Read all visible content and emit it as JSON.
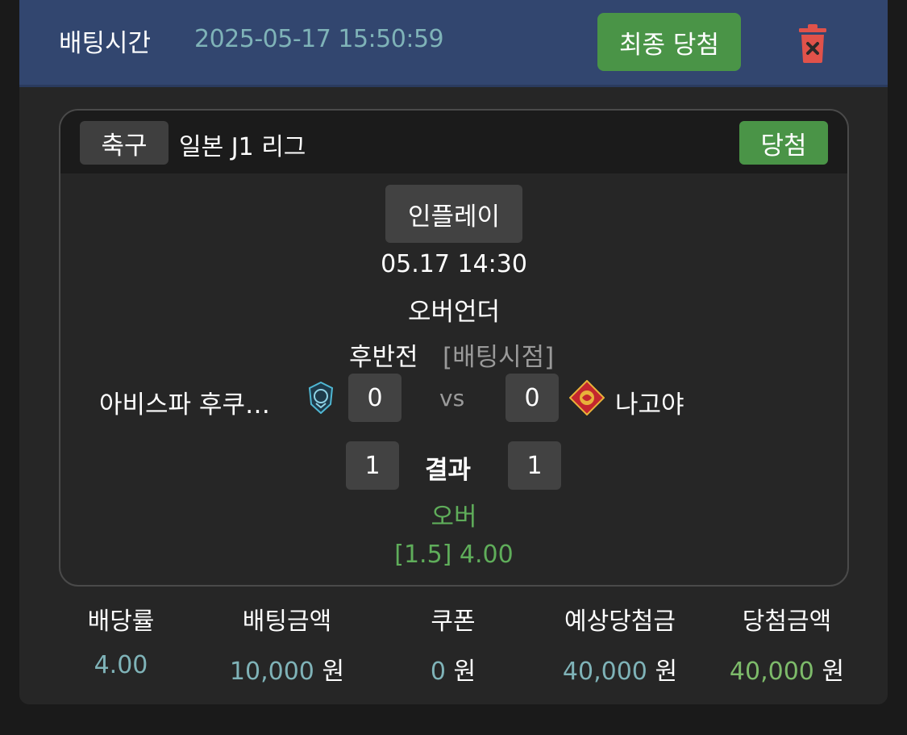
{
  "header": {
    "bet_time_label": "배팅시간",
    "bet_time_value": "2025-05-17 15:50:59",
    "final_win_button": "최종 당첨",
    "trash_icon": "trash-icon"
  },
  "match": {
    "sport": "축구",
    "league": "일본 J1 리그",
    "status_badge": "당첨",
    "inplay_label": "인플레이",
    "datetime": "05.17 14:30",
    "market": "오버언더",
    "period": "후반전",
    "bet_point_label": "[배팅시점]",
    "home_team": "아비스파 후쿠…",
    "away_team": "나고야",
    "home_score_at_bet": "0",
    "away_score_at_bet": "0",
    "vs_label": "vs",
    "home_result": "1",
    "away_result": "1",
    "result_label": "결과",
    "selection": "오버",
    "odds_line": "[1.5] 4.00"
  },
  "stats": [
    {
      "label": "배당률",
      "value": "4.00",
      "unit": ""
    },
    {
      "label": "배팅금액",
      "value": "10,000",
      "unit": "원"
    },
    {
      "label": "쿠폰",
      "value": "0",
      "unit": "원"
    },
    {
      "label": "예상당첨금",
      "value": "40,000",
      "unit": "원"
    },
    {
      "label": "당첨금액",
      "value": "40,000",
      "unit": "원"
    }
  ],
  "colors": {
    "header_bg": "#32466f",
    "win_green": "#4a9447",
    "teal_text": "#7fb3b8",
    "result_green": "#5fad5a",
    "trash_red": "#e0524a"
  }
}
